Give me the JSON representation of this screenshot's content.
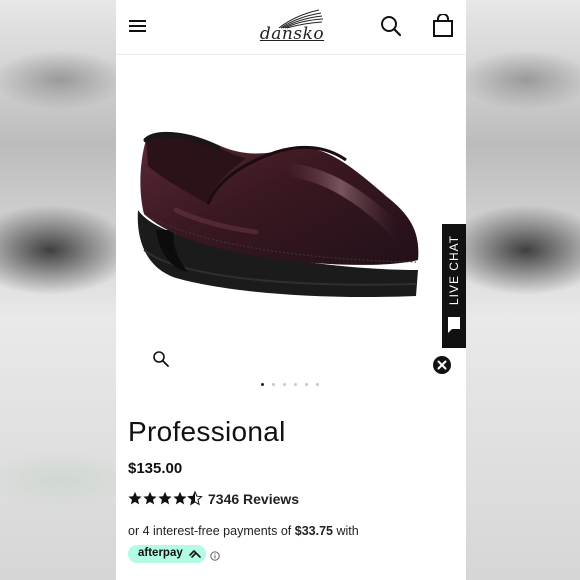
{
  "header": {
    "brand": "dansko",
    "menu_icon": "hamburger-menu-icon",
    "search_icon": "search-icon",
    "cart_icon": "shopping-bag-icon"
  },
  "gallery": {
    "image_alt": "Dansko Professional clog in burgundy (cordovan) leather",
    "zoom_icon": "magnifier-icon",
    "slide_count": 6,
    "active_slide": 1
  },
  "live_chat": {
    "label": "LIVE CHAT",
    "icon": "chat-bubble-icon",
    "close_icon": "close-icon"
  },
  "product": {
    "title": "Professional",
    "price": "$135.00",
    "rating_value": 4.5,
    "rating_max": 5,
    "reviews_label": "7346 Reviews"
  },
  "payment": {
    "prefix": "or 4 interest-free payments of ",
    "amount": "$33.75",
    "suffix": " with",
    "provider": "afterpay",
    "info_icon": "info-icon"
  },
  "colors": {
    "afterpay_mint": "#b2fce4",
    "text": "#111111",
    "chat_bg": "#111111"
  }
}
